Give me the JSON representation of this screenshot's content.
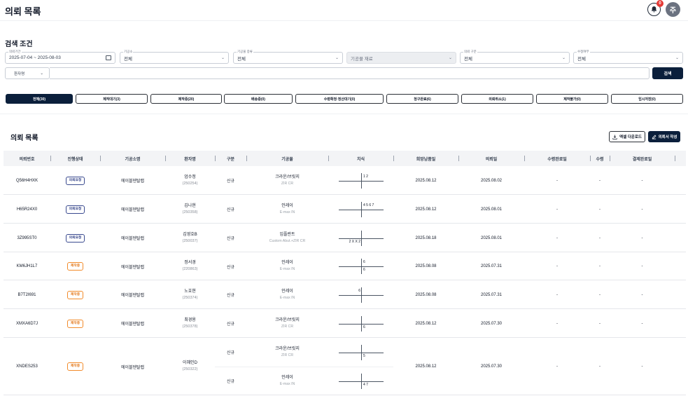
{
  "header": {
    "title": "의뢰 목록",
    "notification_count": "0",
    "avatar_initial": "주"
  },
  "search": {
    "section_title": "검색 조건",
    "period": {
      "label": "의뢰기간",
      "value": "2025-07-04 ~ 2025-08-03"
    },
    "clinic": {
      "label": "기공소",
      "value": "전체"
    },
    "material_type": {
      "label": "기공물 종류",
      "value": "전체"
    },
    "material": {
      "value": "기공물 재료"
    },
    "order_type": {
      "label": "의뢰 구분",
      "value": "전체"
    },
    "revision": {
      "label": "수정여부",
      "value": "전체"
    },
    "patient_select": "환자명",
    "patient_placeholder": "",
    "search_button": "검색"
  },
  "tabs": [
    {
      "label": "전체(30)",
      "active": true
    },
    {
      "label": "제작대기(3)",
      "active": false
    },
    {
      "label": "제작중(20)",
      "active": false
    },
    {
      "label": "배송중(0)",
      "active": false
    },
    {
      "label": "수령확정·정산대기(0)",
      "active": false
    },
    {
      "label": "청구완료(6)",
      "active": false
    },
    {
      "label": "의뢰취소(1)",
      "active": false
    },
    {
      "label": "제작불가(0)",
      "active": false
    },
    {
      "label": "임시저장(0)",
      "active": false
    }
  ],
  "list": {
    "title": "의뢰 목록",
    "excel_button": "엑셀 다운로드",
    "write_button": "의뢰서 작성",
    "columns": [
      "의뢰번호",
      "진행상태",
      "기공소명",
      "환자명",
      "구분",
      "기공물",
      "치식",
      "희망납품일",
      "의뢰일",
      "수령완료일",
      "수령",
      "결제완료일"
    ],
    "rows": [
      {
        "id": "Q56H4HXK",
        "status": "의뢰요청",
        "status_type": "req",
        "clinic": "에이블덴탈랩",
        "patient": "엄수정",
        "patient_no": "(250254)",
        "items": [
          {
            "type": "신규",
            "material": "크라운/브릿지",
            "material_sub": "ZIR CR",
            "teeth": {
              "ul": "",
              "ur": "1 2",
              "ll": "",
              "lr": ""
            }
          }
        ],
        "due": "2025.08.12",
        "ordered": "2025.08.02",
        "received_date": "-",
        "received": "-",
        "paid": "-"
      },
      {
        "id": "H65R24X0",
        "status": "의뢰요청",
        "status_type": "req",
        "clinic": "에이블덴탈랩",
        "patient": "김나현",
        "patient_no": "(250358)",
        "items": [
          {
            "type": "신규",
            "material": "인레이",
            "material_sub": "E-max IN",
            "teeth": {
              "ul": "",
              "ur": "4 5 6 7",
              "ll": "",
              "lr": ""
            }
          }
        ],
        "due": "2025.08.12",
        "ordered": "2025.08.01",
        "received_date": "-",
        "received": "-",
        "paid": "-"
      },
      {
        "id": "3Z995ST0",
        "status": "의뢰요청",
        "status_type": "req",
        "clinic": "에이블덴탈랩",
        "patient": "김영호B",
        "patient_no": "(250037)",
        "items": [
          {
            "type": "신규",
            "material": "임플란트",
            "material_sub": "Custom Abut.+ZIR CR",
            "teeth": {
              "ul": "",
              "ur": "",
              "ll": "2 X X 2",
              "lr": ""
            }
          }
        ],
        "due": "2025.08.18",
        "ordered": "2025.08.01",
        "received_date": "-",
        "received": "-",
        "paid": "-"
      },
      {
        "id": "KM6JH1L7",
        "status": "제작중",
        "status_type": "mak",
        "clinic": "에이블덴탈랩",
        "patient": "정서경",
        "patient_no": "(220863)",
        "items": [
          {
            "type": "신규",
            "material": "인레이",
            "material_sub": "E-max IN",
            "teeth": {
              "ul": "",
              "ur": "6",
              "ll": "",
              "lr": "6"
            }
          }
        ],
        "due": "2025.08.08",
        "ordered": "2025.07.31",
        "received_date": "-",
        "received": "-",
        "paid": "-"
      },
      {
        "id": "B7T2I691",
        "status": "제작중",
        "status_type": "mak",
        "clinic": "에이블덴탈랩",
        "patient": "노호현",
        "patient_no": "(250374)",
        "items": [
          {
            "type": "신규",
            "material": "인레이",
            "material_sub": "E-max IN",
            "teeth": {
              "ul": "6",
              "ur": "",
              "ll": "",
              "lr": ""
            }
          }
        ],
        "due": "2025.08.08",
        "ordered": "2025.07.31",
        "received_date": "-",
        "received": "-",
        "paid": "-"
      },
      {
        "id": "XMXA6D7J",
        "status": "제작중",
        "status_type": "mak",
        "clinic": "에이블덴탈랩",
        "patient": "최경용",
        "patient_no": "(250378)",
        "items": [
          {
            "type": "신규",
            "material": "크라운/브릿지",
            "material_sub": "ZIR CR",
            "teeth": {
              "ul": "",
              "ur": "",
              "ll": "",
              "lr": "6"
            }
          }
        ],
        "due": "2025.08.12",
        "ordered": "2025.07.30",
        "received_date": "-",
        "received": "-",
        "paid": "-"
      },
      {
        "id": "XNDES253",
        "status": "제작중",
        "status_type": "mak",
        "clinic": "에이블덴탈랩",
        "patient": "이혜인D",
        "patient_no": "(250322)",
        "items": [
          {
            "type": "신규",
            "material": "크라운/브릿지",
            "material_sub": "ZIR CR",
            "teeth": {
              "ul": "",
              "ur": "",
              "ll": "",
              "lr": "5"
            }
          },
          {
            "type": "신규",
            "material": "인레이",
            "material_sub": "E-max IN",
            "teeth": {
              "ul": "",
              "ur": "",
              "ll": "",
              "lr": "4  7"
            }
          }
        ],
        "due": "2025.08.12",
        "ordered": "2025.07.30",
        "received_date": "-",
        "received": "-",
        "paid": "-"
      }
    ]
  }
}
